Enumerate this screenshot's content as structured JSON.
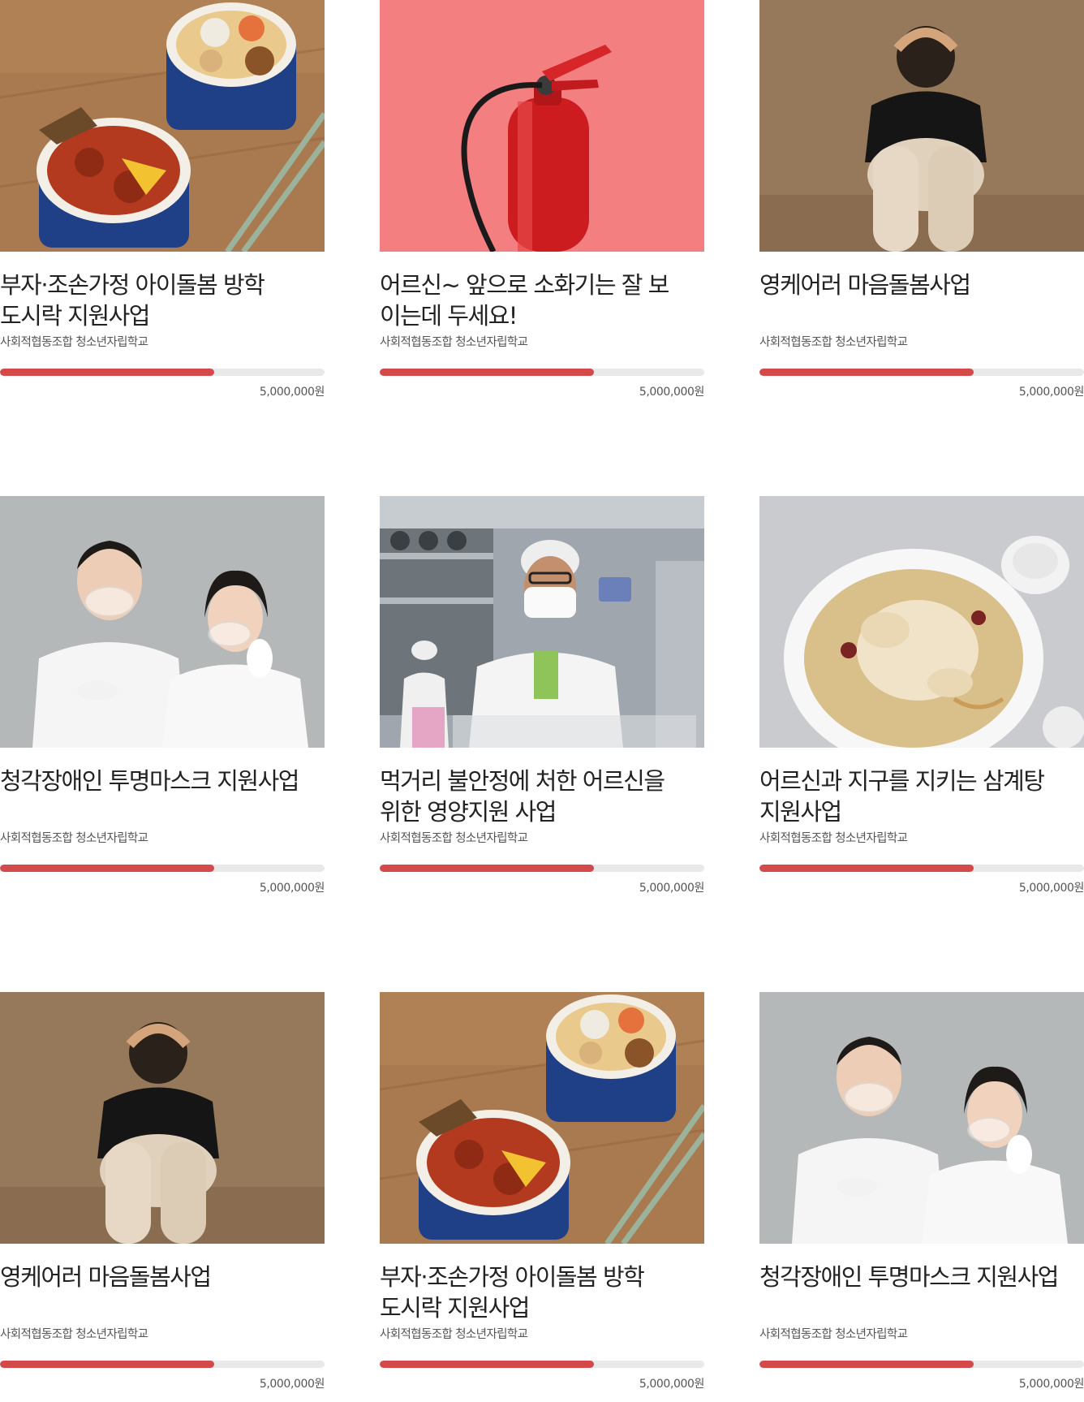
{
  "projects": [
    {
      "image_icon": "lunchbox-photo-icon",
      "title_line1": "부자·조손가정 아이돌봄 방학",
      "title_line2": "도시락 지원사업",
      "organization": "사회적협동조합 청소년자립학교",
      "progress": 0.66,
      "amount": "5,000,000원"
    },
    {
      "image_icon": "fire-extinguisher-photo-icon",
      "title_line1": "어르신~ 앞으로 소화기는 잘 보",
      "title_line2": "이는데 두세요!",
      "organization": "사회적협동조합 청소년자립학교",
      "progress": 0.66,
      "amount": "5,000,000원"
    },
    {
      "image_icon": "sad-person-photo-icon",
      "title_line1": "영케어러 마음돌봄사업",
      "title_line2": "",
      "organization": "사회적협동조합 청소년자립학교",
      "progress": 0.66,
      "amount": "5,000,000원"
    },
    {
      "image_icon": "clear-mask-people-photo-icon",
      "title_line1": "청각장애인 투명마스크 지원사업",
      "title_line2": "",
      "organization": "사회적협동조합 청소년자립학교",
      "progress": 0.66,
      "amount": "5,000,000원"
    },
    {
      "image_icon": "kitchen-worker-photo-icon",
      "title_line1": "먹거리 불안정에 처한 어르신을",
      "title_line2": "위한 영양지원 사업",
      "organization": "사회적협동조합 청소년자립학교",
      "progress": 0.66,
      "amount": "5,000,000원"
    },
    {
      "image_icon": "samgyetang-photo-icon",
      "title_line1": "어르신과 지구를 지키는 삼계탕",
      "title_line2": "지원사업",
      "organization": "사회적협동조합 청소년자립학교",
      "progress": 0.66,
      "amount": "5,000,000원"
    },
    {
      "image_icon": "sad-person-photo-icon",
      "title_line1": "영케어러 마음돌봄사업",
      "title_line2": "",
      "organization": "사회적협동조합 청소년자립학교",
      "progress": 0.66,
      "amount": "5,000,000원"
    },
    {
      "image_icon": "lunchbox-photo-icon",
      "title_line1": "부자·조손가정 아이돌봄 방학",
      "title_line2": "도시락 지원사업",
      "organization": "사회적협동조합 청소년자립학교",
      "progress": 0.66,
      "amount": "5,000,000원"
    },
    {
      "image_icon": "clear-mask-people-photo-icon",
      "title_line1": "청각장애인 투명마스크 지원사업",
      "title_line2": "",
      "organization": "사회적협동조합 청소년자립학교",
      "progress": 0.66,
      "amount": "5,000,000원"
    }
  ],
  "colors": {
    "progress_fill": "#d44a4a",
    "progress_track": "#e9e9e9",
    "title_text": "#222222",
    "meta_text": "#555555"
  }
}
